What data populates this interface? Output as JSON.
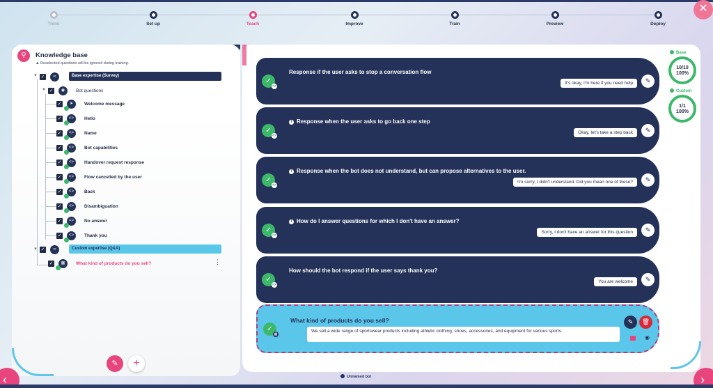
{
  "steps": [
    {
      "label": "Think",
      "state": "done",
      "icon": "lightbulb-icon"
    },
    {
      "label": "Set up",
      "state": "normal",
      "icon": "gear-icon"
    },
    {
      "label": "Teach",
      "state": "active",
      "icon": "pencil-icon"
    },
    {
      "label": "Improve",
      "state": "normal",
      "icon": "triangle-icon"
    },
    {
      "label": "Train",
      "state": "normal",
      "icon": "dumbbell-icon"
    },
    {
      "label": "Preview",
      "state": "normal",
      "icon": "screen-icon"
    },
    {
      "label": "Deploy",
      "state": "normal",
      "icon": "rocket-icon"
    }
  ],
  "knowledge_base": {
    "title": "Knowledge base",
    "warning": "Deselected questions will be ignored during training.",
    "base_expertise": "Base expertise (Survey)",
    "bot_questions": "Bot questions",
    "items": [
      "Welcome message",
      "Hello",
      "Name",
      "Bot capabilities",
      "Handover request response",
      "Flow cancelled by the user",
      "Back",
      "Disambiguation",
      "No answer",
      "Thank you"
    ],
    "custom_expertise": "Custom expertise (Q&A)",
    "custom_items": [
      "What kind of products do you sell?"
    ]
  },
  "cards": [
    {
      "question": "Response if the user asks to stop a conversation flow",
      "answer": "It's okay, I'm here if you need help",
      "info": false
    },
    {
      "question": "Response when the user asks to go back one step",
      "answer": "Okay, let's take a step back",
      "info": true
    },
    {
      "question": "Response when the bot does not understand, but can propose alternatives to the user.",
      "answer": "I'm sorry, I didn't understand. Did you mean one of these?",
      "info": true
    },
    {
      "question": "How do I answer questions for which I don't have an answer?",
      "answer": "Sorry, I don't have an answer for this question",
      "info": true
    },
    {
      "question": "How should the bot respond if the user says thank you?",
      "answer": "You are welcome",
      "info": false
    }
  ],
  "selected_card": {
    "question": "What kind of products do you sell?",
    "answer": "We sell a wide range of sportswear products including athletic clothing, shoes, accessories, and equipment for various sports."
  },
  "stats": {
    "base_label": "Base",
    "base_count": "10/10",
    "base_pct": "100%",
    "custom_label": "Custom",
    "custom_count": "1/1",
    "custom_pct": "100%"
  },
  "bot_name": "Unnamed bot",
  "colors": {
    "navy": "#243159",
    "pink": "#e8447d",
    "green": "#3db86a",
    "cyan": "#5ac6ea"
  }
}
